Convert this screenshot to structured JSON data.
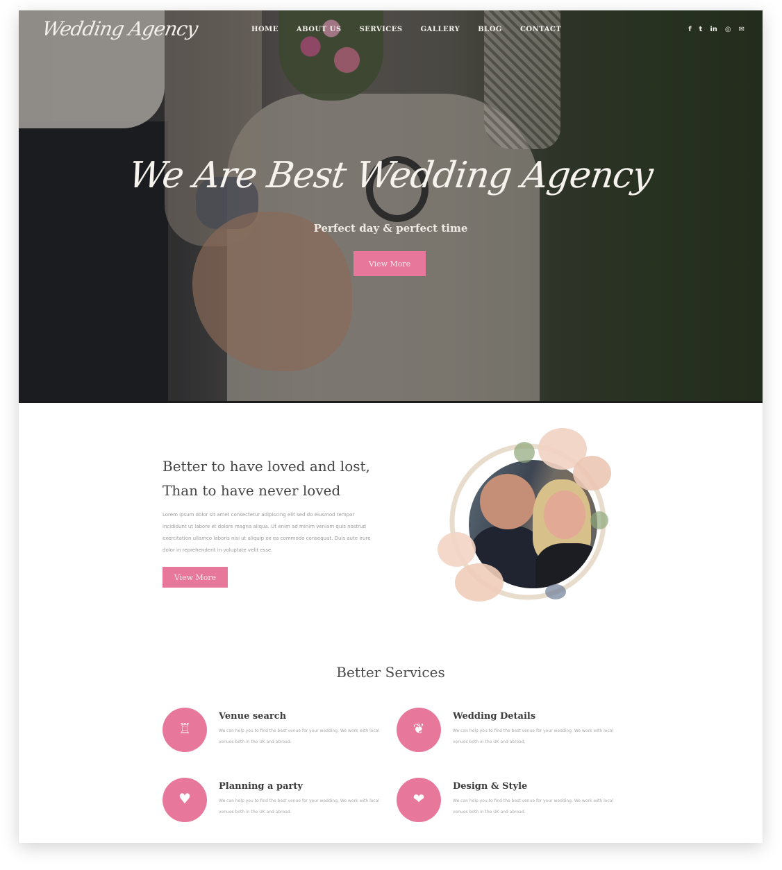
{
  "brand": {
    "logo_text": "Wedding Agency"
  },
  "nav": {
    "items": [
      "HOME",
      "ABOUT US",
      "SERVICES",
      "GALLERY",
      "BLOG",
      "CONTACT"
    ]
  },
  "social": {
    "icons": [
      "f",
      "t",
      "in",
      "◎",
      "✉"
    ],
    "icon_names": [
      "facebook-icon",
      "twitter-icon",
      "linkedin-icon",
      "instagram-icon",
      "email-icon"
    ]
  },
  "hero": {
    "title": "We Are Best Wedding Agency",
    "subtitle": "Perfect day & perfect time",
    "button_label": "View More"
  },
  "intro": {
    "title_line1": "Better to have loved and lost,",
    "title_line2": "Than to have never loved",
    "body": "Lorem ipsum dolor sit amet consectetur adipiscing elit sed do eiusmod tempor incididunt ut labore et dolore magna aliqua. Ut enim ad minim veniam quis nostrud exercitation ullamco laboris nisi ut aliquip ex ea commodo consequat. Duis aute irure dolor in reprehenderit in voluptate velit esse.",
    "button_label": "View More"
  },
  "services": {
    "title": "Better Services",
    "items": [
      {
        "title": "Venue search",
        "text": "We can help you to find the best venue for your wedding. We work with local venues both in the UK and abroad.",
        "icon": "♖"
      },
      {
        "title": "Wedding Details",
        "text": "We can help you to find the best venue for your wedding. We work with local venues both in the UK and abroad.",
        "icon": "❦"
      },
      {
        "title": "Planning a party",
        "text": "We can help you to find the best venue for your wedding. We work with local venues both in the UK and abroad.",
        "icon": "♥"
      },
      {
        "title": "Design & Style",
        "text": "We can help you to find the best venue for your wedding. We work with local venues both in the UK and abroad.",
        "icon": "❤"
      }
    ]
  },
  "colors": {
    "accent": "#e8779c"
  }
}
